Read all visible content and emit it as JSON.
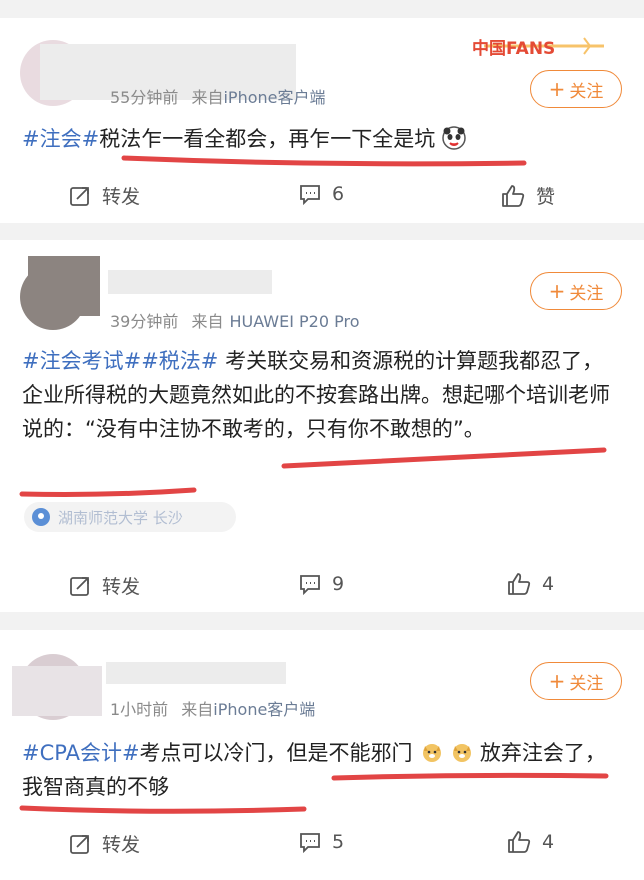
{
  "colors": {
    "background": "#f2f2f2",
    "card": "#ffffff",
    "hashtag": "#3f6fbf",
    "follow_accent": "#f08a3a",
    "underline_red": "#e24545",
    "meta_gray": "#8a8a8a"
  },
  "posts": [
    {
      "time": "55分钟前",
      "from": "来自",
      "source": "iPhone客户端",
      "follow_label": "关注",
      "badge_text": "中国FANS",
      "content_segments": [
        {
          "text": "#注会#",
          "type": "tag"
        },
        {
          "text": "税法乍一看全都会，再乍一下全是坑",
          "type": "text"
        }
      ],
      "emoji": "panda-emoji",
      "actions": {
        "repost": "转发",
        "comment": "6",
        "like": "赞"
      }
    },
    {
      "time": "39分钟前",
      "from": "来自",
      "source": "HUAWEI P20 Pro",
      "follow_label": "关注",
      "content_segments": [
        {
          "text": "#注会考试##税法#",
          "type": "tag"
        },
        {
          "text": " 考关联交易和资源税的计算题我都忍了，企业所得税的大题竟然如此的不按套路出牌。想起哪个培训老师说的：“没有中注协不敢考的，只有你不敢想的”。",
          "type": "text"
        }
      ],
      "location": "湖南师范大学 长沙",
      "actions": {
        "repost": "转发",
        "comment": "9",
        "like": "4"
      }
    },
    {
      "time": "1小时前",
      "from": "来自",
      "source": "iPhone客户端",
      "follow_label": "关注",
      "content_segments": [
        {
          "text": "#CPA会计#",
          "type": "tag"
        },
        {
          "text": "考点可以冷门，但是不能邪门",
          "type": "text"
        },
        {
          "text": " 放弃注会了，我智商真的不够",
          "type": "text"
        }
      ],
      "emoji": "doge-emoji",
      "actions": {
        "repost": "转发",
        "comment": "5",
        "like": "4"
      }
    }
  ]
}
